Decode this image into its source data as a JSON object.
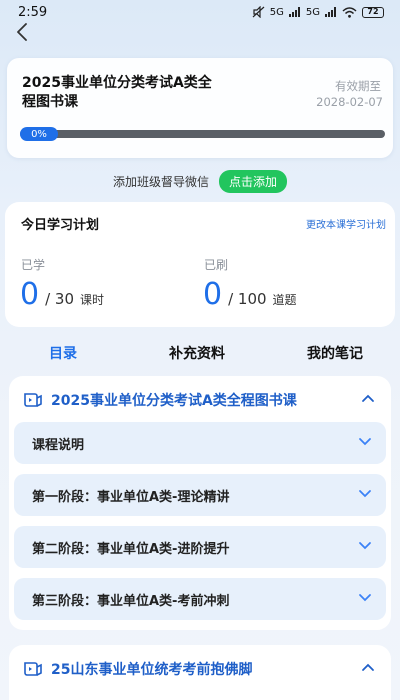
{
  "status_bar": {
    "time": "2:59",
    "network": "5G",
    "network2": "5G",
    "battery": "72"
  },
  "course": {
    "title": "2025事业单位分类考试A类全程图书课",
    "expiry_label": "有效期至",
    "expiry_date": "2028-02-07",
    "progress_label": "0%",
    "progress": 0
  },
  "wechat": {
    "text": "添加班级督导微信",
    "button": "点击添加"
  },
  "plan": {
    "title": "今日学习计划",
    "change_link": "更改本课学习计划",
    "learned_label": "已学",
    "learned_value": "0",
    "learned_total": "/ 30",
    "learned_unit": "课时",
    "practiced_label": "已刷",
    "practiced_value": "0",
    "practiced_total": "/ 100",
    "practiced_unit": "道题"
  },
  "tabs": [
    {
      "label": "目录",
      "active": true
    },
    {
      "label": "补充资料",
      "active": false
    },
    {
      "label": "我的笔记",
      "active": false
    }
  ],
  "sections": [
    {
      "title": "2025事业单位分类考试A类全程图书课",
      "chapters": [
        "课程说明",
        "第一阶段：事业单位A类-理论精讲",
        "第二阶段：事业单位A类-进阶提升",
        "第三阶段：事业单位A类-考前冲刺"
      ]
    },
    {
      "title": "25山东事业单位统考考前抱佛脚",
      "chapters": []
    }
  ],
  "colors": {
    "accent": "#1f6fe8",
    "green": "#22c55e",
    "chapter_bg": "#e7f0fb"
  },
  "icons": [
    "back-arrow-icon",
    "book-icon",
    "chevron-up-icon",
    "chevron-down-icon"
  ]
}
